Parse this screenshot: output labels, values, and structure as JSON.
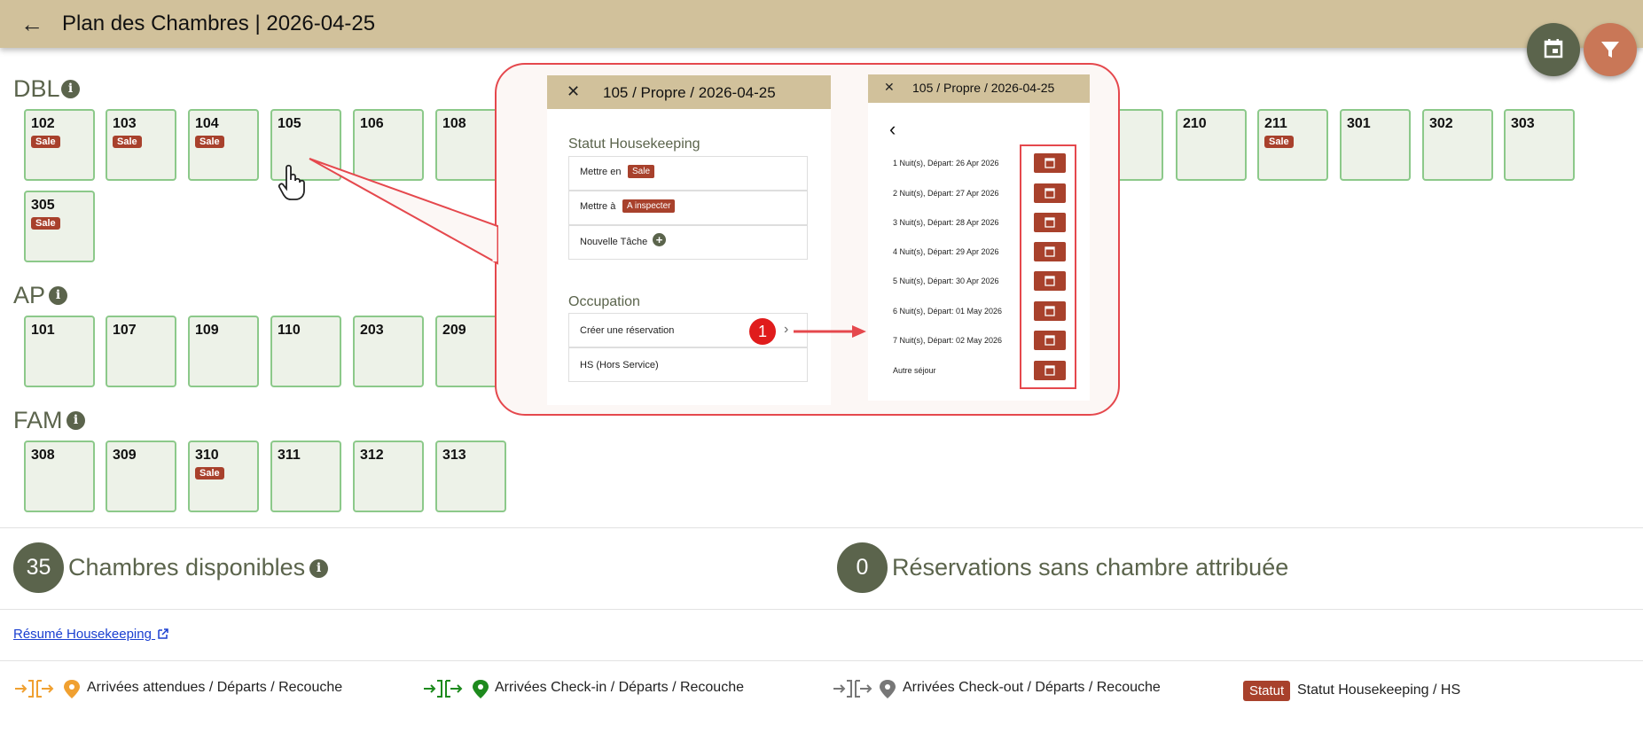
{
  "header": {
    "title": "Plan des Chambres | 2026-04-25",
    "back_icon": "←"
  },
  "fabs": {
    "calendar_icon": "calendar-icon",
    "filter_icon": "filter-icon",
    "calendar_color": "#5b644c",
    "filter_color": "#c97757"
  },
  "sections": {
    "dbl": {
      "title": "DBL",
      "rooms": [
        {
          "number": "102",
          "badge": "Sale"
        },
        {
          "number": "103",
          "badge": "Sale"
        },
        {
          "number": "104",
          "badge": "Sale"
        },
        {
          "number": "105",
          "badge": ""
        },
        {
          "number": "106",
          "badge": ""
        },
        {
          "number": "108",
          "badge": ""
        },
        {
          "number": "210",
          "badge": ""
        },
        {
          "number": "211",
          "badge": "Sale"
        },
        {
          "number": "301",
          "badge": ""
        },
        {
          "number": "302",
          "badge": ""
        },
        {
          "number": "303",
          "badge": ""
        },
        {
          "number": "305",
          "badge": "Sale"
        }
      ]
    },
    "ap": {
      "title": "AP",
      "rooms": [
        {
          "number": "101",
          "badge": ""
        },
        {
          "number": "107",
          "badge": ""
        },
        {
          "number": "109",
          "badge": ""
        },
        {
          "number": "110",
          "badge": ""
        },
        {
          "number": "203",
          "badge": ""
        },
        {
          "number": "209",
          "badge": ""
        }
      ]
    },
    "fam": {
      "title": "FAM",
      "rooms": [
        {
          "number": "308",
          "badge": ""
        },
        {
          "number": "309",
          "badge": ""
        },
        {
          "number": "310",
          "badge": "Sale"
        },
        {
          "number": "311",
          "badge": ""
        },
        {
          "number": "312",
          "badge": ""
        },
        {
          "number": "313",
          "badge": ""
        }
      ]
    }
  },
  "stats": {
    "available_count": "35",
    "available_label": "Chambres disponibles",
    "unassigned_count": "0",
    "unassigned_label": "Réservations sans chambre attribuée"
  },
  "housekeeping_link": "Résumé Housekeeping",
  "legend": {
    "expected": "Arrivées attendues / Départs / Recouche",
    "checkin": "Arrivées Check-in / Départs / Recouche",
    "checkout": "Arrivées Check-out / Départs / Recouche",
    "statut_badge": "Statut",
    "statut_text": "Statut Housekeeping / HS"
  },
  "callout": {
    "left_panel": {
      "title": "105 / Propre / 2026-04-25",
      "hk_heading": "Statut Housekeeping",
      "set_dirty_label": "Mettre en",
      "set_dirty_badge": "Sale",
      "set_inspect_label": "Mettre à",
      "set_inspect_badge": "A inspecter",
      "new_task_label": "Nouvelle Tâche",
      "occupation_heading": "Occupation",
      "create_reservation": "Créer une réservation",
      "out_of_service": "HS (Hors Service)",
      "step_marker": "1"
    },
    "right_panel": {
      "title": "105 / Propre / 2026-04-25",
      "stays": [
        "1 Nuit(s), Départ: 26 Apr 2026",
        "2 Nuit(s), Départ: 27 Apr 2026",
        "3 Nuit(s), Départ: 28 Apr 2026",
        "4 Nuit(s), Départ: 29 Apr 2026",
        "5 Nuit(s), Départ: 30 Apr 2026",
        "6 Nuit(s), Départ: 01 May 2026",
        "7 Nuit(s), Départ: 02 May 2026",
        "Autre séjour"
      ]
    }
  }
}
